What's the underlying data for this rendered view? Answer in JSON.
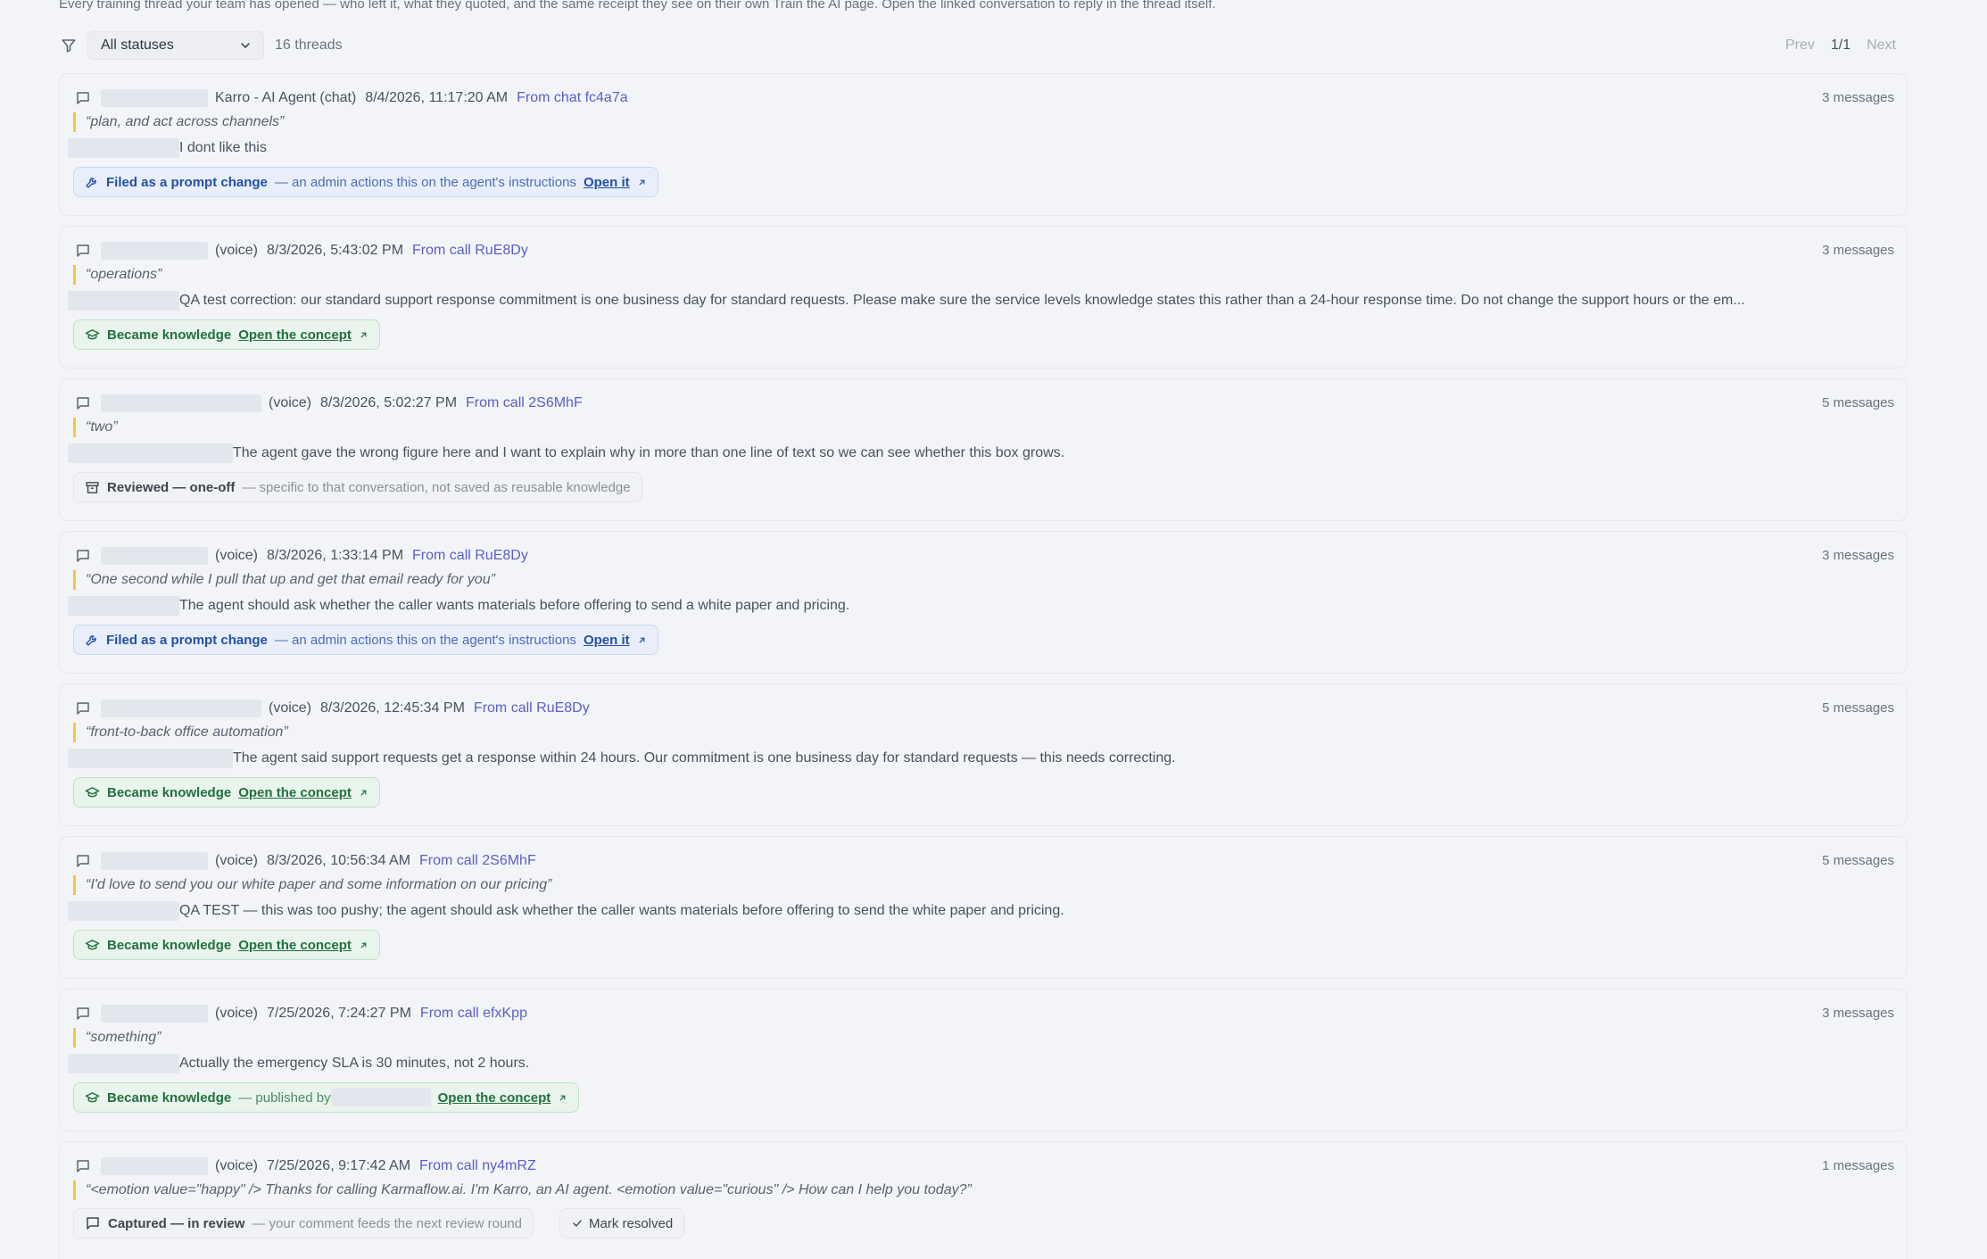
{
  "intro": "Every training thread your team has opened — who left it, what they quoted, and the same receipt they see on their own Train the AI page. Open the linked conversation to reply in the thread itself.",
  "toolbar": {
    "filter_icon": "filter-icon",
    "status_filter": "All statuses",
    "thread_count": "16 threads",
    "prev": "Prev",
    "page_indicator": "1/1",
    "next": "Next"
  },
  "threads": [
    {
      "who": "Karro - AI Agent (chat)",
      "when": "8/4/2026, 11:17:20 AM",
      "source": "From chat fc4a7a",
      "messages": "3 messages",
      "quote": "“plan, and act across channels”",
      "comment": "I dont like this",
      "status": {
        "kind": "prompt",
        "icon": "wrench-icon",
        "label": "Filed as a prompt change",
        "note": "— an admin actions this on the agent's instructions",
        "link": "Open it"
      }
    },
    {
      "who": "(voice)",
      "when": "8/3/2026, 5:43:02 PM",
      "source": "From call RuE8Dy",
      "messages": "3 messages",
      "quote": "“operations”",
      "comment": "QA test correction: our standard support response commitment is one business day for standard requests. Please make sure the service levels knowledge states this rather than a 24-hour response time. Do not change the support hours or the em...",
      "status": {
        "kind": "knowledge",
        "icon": "graduation-cap-icon",
        "label": "Became knowledge",
        "note": "",
        "link": "Open the concept"
      }
    },
    {
      "who": "(voice)",
      "when": "8/3/2026, 5:02:27 PM",
      "source": "From call 2S6MhF",
      "messages": "5 messages",
      "quote": "“two”",
      "comment": "The agent gave the wrong figure here and I want to explain why in more than one line of text so we can see whether this box grows.",
      "status": {
        "kind": "oneoff",
        "icon": "archive-icon",
        "label": "Reviewed — one-off",
        "note": "— specific to that conversation, not saved as reusable knowledge",
        "link": ""
      }
    },
    {
      "who": "(voice)",
      "when": "8/3/2026, 1:33:14 PM",
      "source": "From call RuE8Dy",
      "messages": "3 messages",
      "quote": "“One second while I pull that up and get that email ready for you”",
      "comment": "The agent should ask whether the caller wants materials before offering to send a white paper and pricing.",
      "status": {
        "kind": "prompt",
        "icon": "wrench-icon",
        "label": "Filed as a prompt change",
        "note": "— an admin actions this on the agent's instructions",
        "link": "Open it"
      }
    },
    {
      "who": "(voice)",
      "when": "8/3/2026, 12:45:34 PM",
      "source": "From call RuE8Dy",
      "messages": "5 messages",
      "quote": "“front-to-back office automation”",
      "comment": "The agent said support requests get a response within 24 hours. Our commitment is one business day for standard requests — this needs correcting.",
      "status": {
        "kind": "knowledge",
        "icon": "graduation-cap-icon",
        "label": "Became knowledge",
        "note": "",
        "link": "Open the concept"
      }
    },
    {
      "who": "(voice)",
      "when": "8/3/2026, 10:56:34 AM",
      "source": "From call 2S6MhF",
      "messages": "5 messages",
      "quote": "“I'd love to send you our white paper and some information on our pricing”",
      "comment": "QA TEST — this was too pushy; the agent should ask whether the caller wants materials before offering to send the white paper and pricing.",
      "status": {
        "kind": "knowledge",
        "icon": "graduation-cap-icon",
        "label": "Became knowledge",
        "note": "",
        "link": "Open the concept"
      }
    },
    {
      "who": "(voice)",
      "when": "7/25/2026, 7:24:27 PM",
      "source": "From call efxKpp",
      "messages": "3 messages",
      "quote": "“something”",
      "comment": "Actually the emergency SLA is 30 minutes, not 2 hours.",
      "status": {
        "kind": "knowledge",
        "icon": "graduation-cap-icon",
        "label": "Became knowledge",
        "note": "— published by",
        "link": "Open the concept"
      }
    },
    {
      "who": "(voice)",
      "when": "7/25/2026, 9:17:42 AM",
      "source": "From call ny4mRZ",
      "messages": "1 messages",
      "quote": "“<emotion value=\"happy\" /> Thanks for calling Karmaflow.ai. I'm Karro, an AI agent. <emotion value=\"curious\" /> How can I help you today?”",
      "comment": "",
      "status": {
        "kind": "review",
        "icon": "chat-bubble-icon",
        "label": "Captured — in review",
        "note": "— your comment feeds the next review round",
        "link": ""
      },
      "resolve_label": "Mark resolved"
    }
  ]
}
